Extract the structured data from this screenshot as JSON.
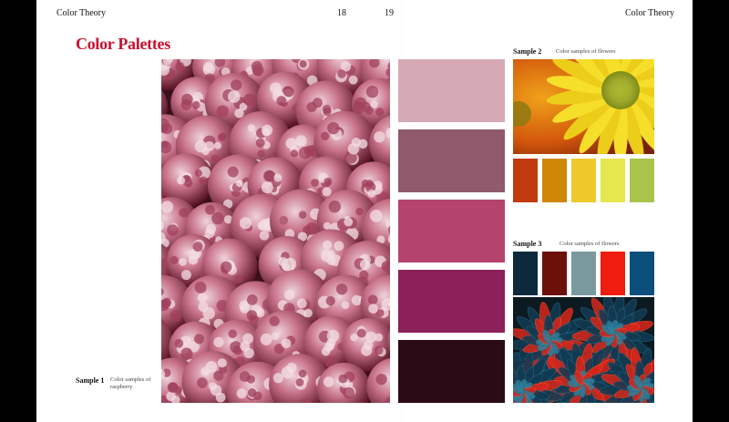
{
  "spread": {
    "left_header": "Color Theory",
    "right_header": "Color Theory",
    "left_page_number": "18",
    "right_page_number": "19"
  },
  "section_title": "Color Palettes",
  "samples": [
    {
      "label": "Sample 1",
      "description": "Color samples of raspberry",
      "palette": [
        "#d6aab5",
        "#8f5a6c",
        "#b5446d",
        "#8b2158",
        "#2b0b16"
      ]
    },
    {
      "label": "Sample 2",
      "description": "Color samples of flowers",
      "palette": [
        "#c13b0e",
        "#cf8707",
        "#efc92c",
        "#e6e64e",
        "#a9c44a"
      ]
    },
    {
      "label": "Sample 3",
      "description": "Color samples of flowers",
      "palette": [
        "#0c2a3c",
        "#6e100a",
        "#7a9aa0",
        "#ef1c0f",
        "#0b4f7d"
      ]
    }
  ]
}
